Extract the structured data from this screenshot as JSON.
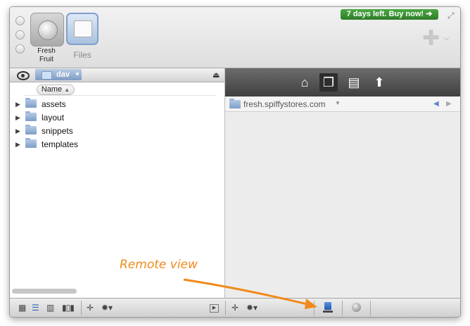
{
  "toolbar": {
    "items": [
      {
        "label": "Fresh\nFruit",
        "icon": "globe-icon"
      },
      {
        "label": "Files",
        "icon": "files-box-icon"
      }
    ],
    "buy_label": "7 days left. Buy now! ➔"
  },
  "left": {
    "breadcrumb": "dav",
    "column": "Name",
    "files": [
      "assets",
      "layout",
      "snippets",
      "templates"
    ]
  },
  "right": {
    "address": "fresh.spiffystores.com"
  },
  "annotation": "Remote view",
  "colors": {
    "accent": "#f08a1a",
    "buy": "#2e7d28",
    "selection": "#7d9bc4"
  }
}
